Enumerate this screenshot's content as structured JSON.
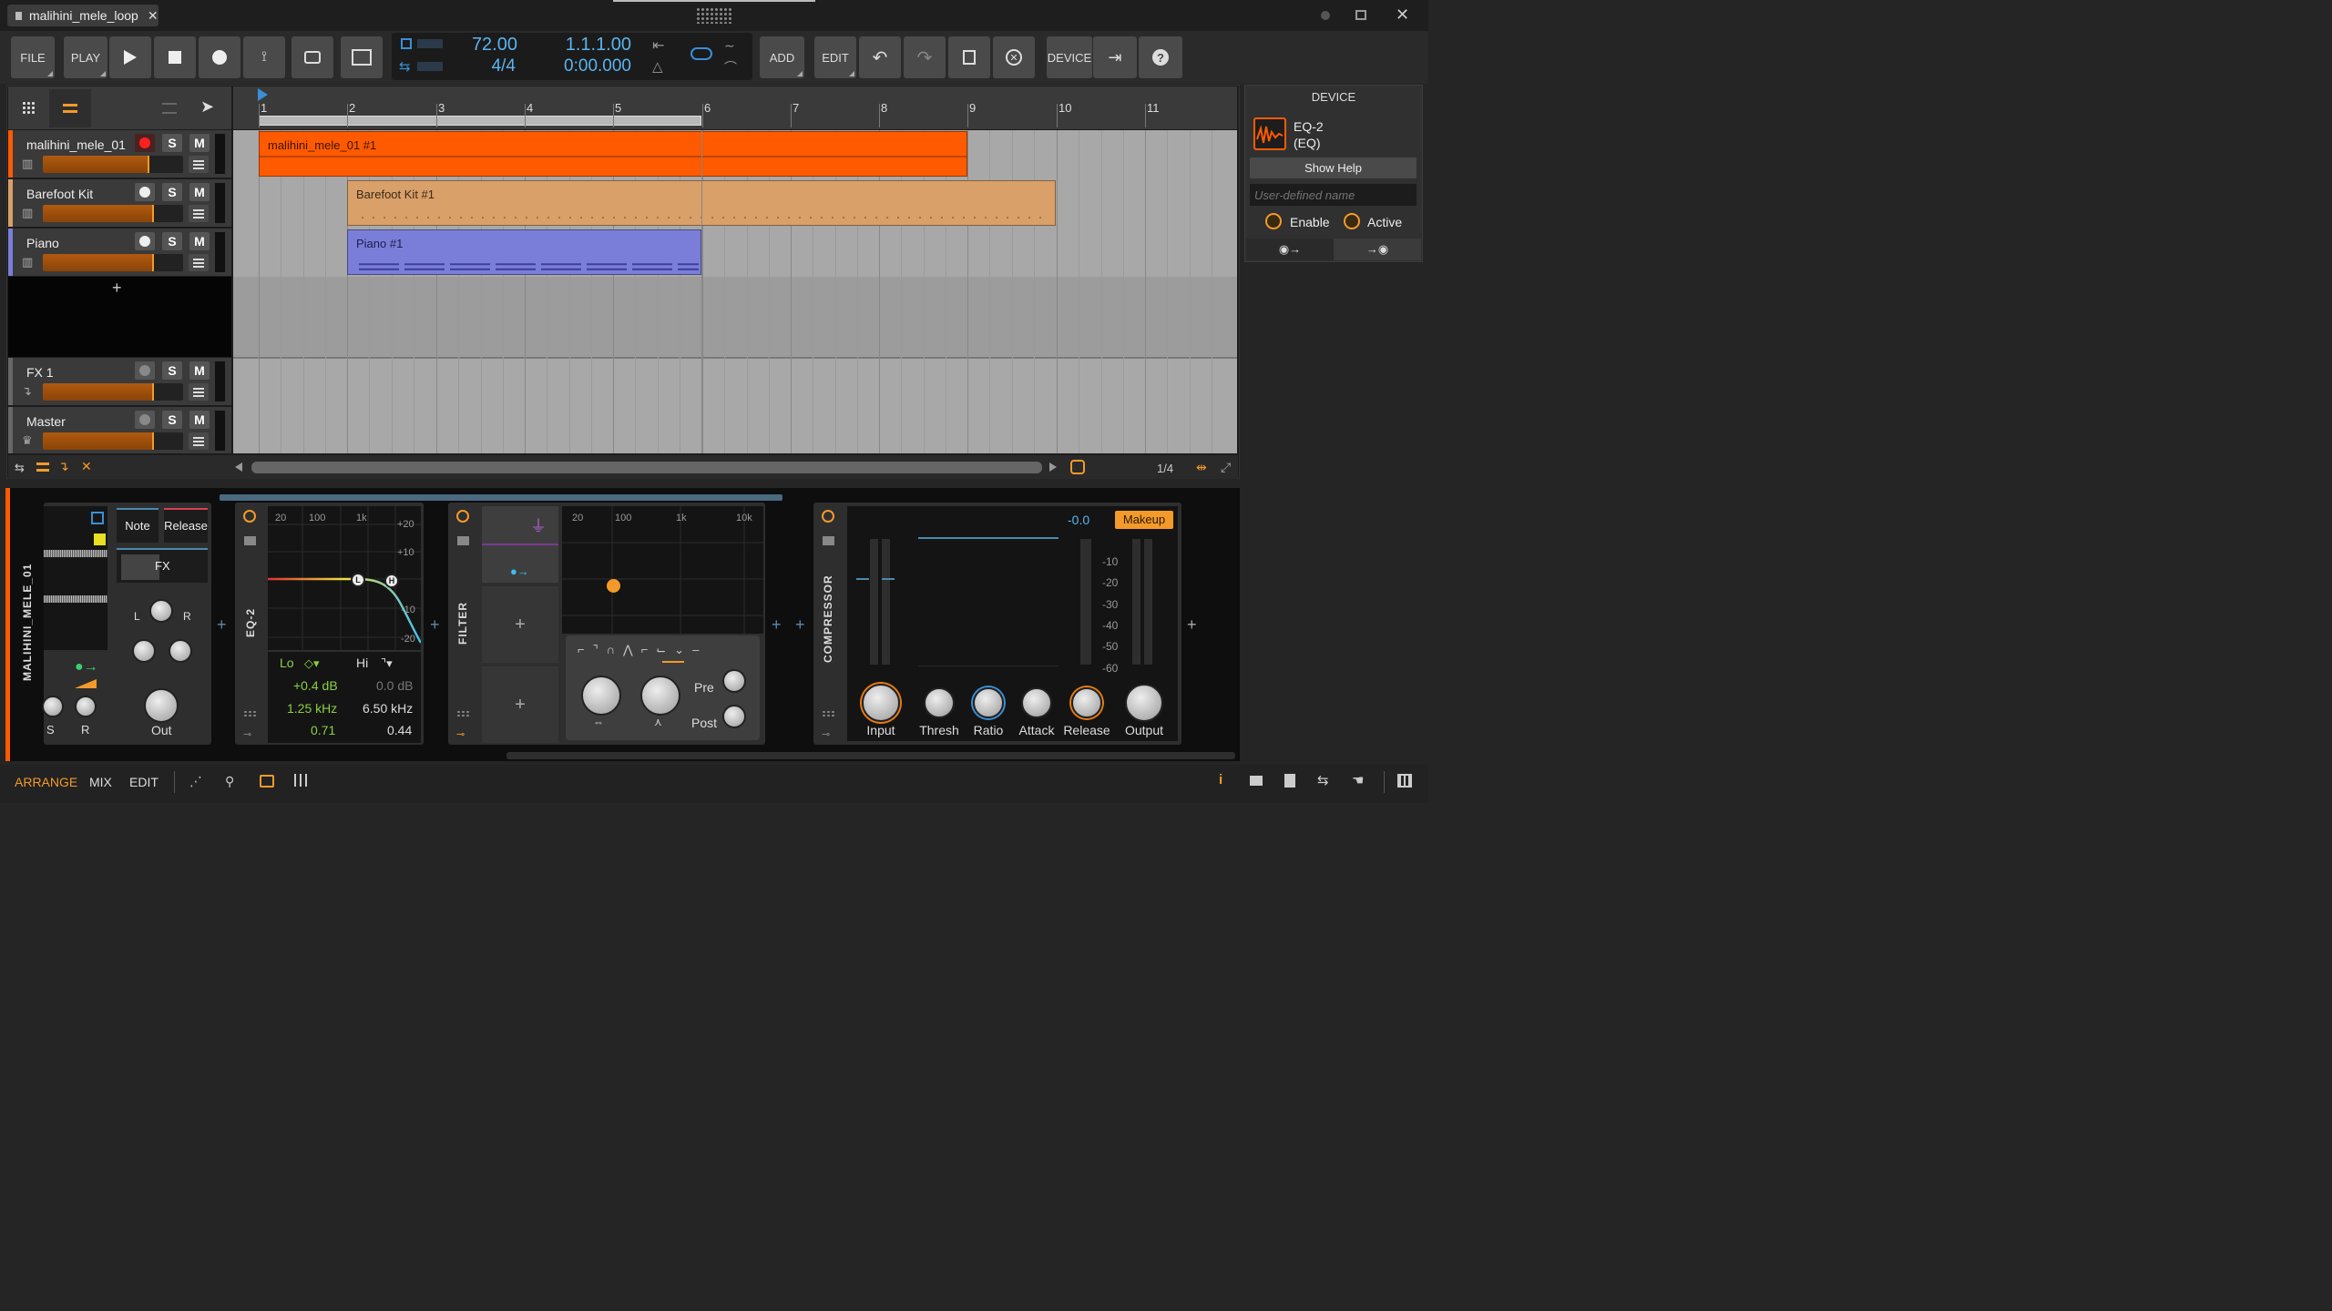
{
  "window": {
    "tab_title": "malihini_mele_loop"
  },
  "toolbar": {
    "file": "FILE",
    "play": "PLAY",
    "tempo": "72.00",
    "time_signature": "4/4",
    "position_beats": "1.1.1.00",
    "position_time": "0:00.000",
    "add": "ADD",
    "edit": "EDIT",
    "device": "DEVICE"
  },
  "ruler": {
    "bars": [
      "1",
      "2",
      "3",
      "4",
      "5",
      "6",
      "7",
      "8",
      "9",
      "10",
      "11"
    ]
  },
  "tracks": [
    {
      "name": "malihini_mele_01",
      "color": "#ff5a00",
      "clip": "malihini_mele_01 #1"
    },
    {
      "name": "Barefoot Kit",
      "color": "#d9a06a",
      "clip": "Barefoot Kit #1"
    },
    {
      "name": "Piano",
      "color": "#7b7ed8",
      "clip": "Piano #1"
    },
    {
      "name": "FX 1"
    },
    {
      "name": "Master"
    }
  ],
  "track_buttons": {
    "solo": "S",
    "mute": "M"
  },
  "add_track": "+",
  "arranger_footer": {
    "zoom": "1/4"
  },
  "inspector": {
    "title": "DEVICE",
    "device_name": "EQ-2",
    "device_type": "(EQ)",
    "show_help": "Show Help",
    "user_name_placeholder": "User-defined name",
    "enable": "Enable",
    "active": "Active"
  },
  "devices": {
    "track_label": "MALIHINI_MELE_01",
    "sampler": {
      "note": "Note",
      "release": "Release",
      "fx": "FX",
      "l": "L",
      "r": "R",
      "s": "S",
      "r2": "R",
      "out": "Out"
    },
    "eq": {
      "label": "EQ-2",
      "freq_20": "20",
      "freq_100": "100",
      "freq_1k": "1k",
      "db_p20": "+20",
      "db_p10": "+10",
      "db_m10": "-10",
      "db_m20": "-20",
      "lo": "Lo",
      "hi": "Hi",
      "lo_gain": "+0.4 dB",
      "hi_gain": "0.0 dB",
      "lo_freq": "1.25 kHz",
      "hi_freq": "6.50 kHz",
      "lo_q": "0.71",
      "hi_q": "0.44",
      "node_l": "L",
      "node_h": "H"
    },
    "filter": {
      "label": "FILTER",
      "freq_20": "20",
      "freq_100": "100",
      "freq_1k": "1k",
      "freq_10k": "10k",
      "pre": "Pre",
      "post": "Post"
    },
    "compressor": {
      "label": "COMPRESSOR",
      "value": "-0.0",
      "makeup": "Makeup",
      "scale": [
        "-10",
        "-20",
        "-30",
        "-40",
        "-50",
        "-60"
      ],
      "knobs": [
        "Input",
        "Thresh",
        "Ratio",
        "Attack",
        "Release",
        "Output"
      ]
    }
  },
  "bottom_bar": {
    "arrange": "ARRANGE",
    "mix": "MIX",
    "edit": "EDIT"
  }
}
